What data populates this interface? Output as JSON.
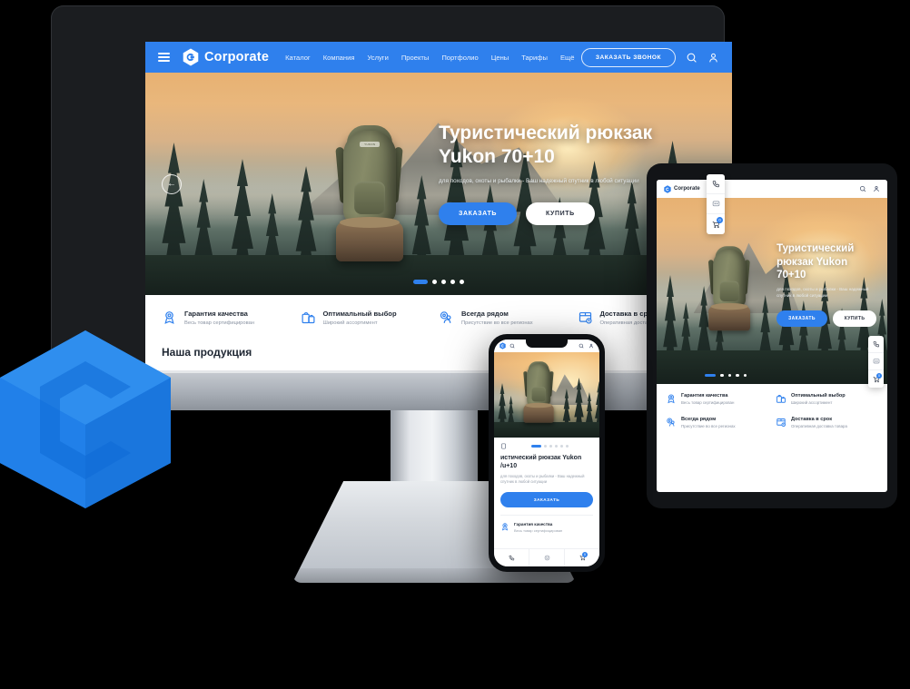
{
  "brand": {
    "name": "Corporate",
    "logo_icon": "hexagon-c-logo"
  },
  "header": {
    "menu_icon": "hamburger-menu-icon",
    "nav": [
      {
        "label": "Каталог"
      },
      {
        "label": "Компания"
      },
      {
        "label": "Услуги"
      },
      {
        "label": "Проекты"
      },
      {
        "label": "Портфолио"
      },
      {
        "label": "Цены"
      },
      {
        "label": "Тарифы"
      },
      {
        "label": "Ещё"
      }
    ],
    "cta_label": "ЗАКАЗАТЬ ЗВОНОК",
    "search_icon": "search-icon",
    "account_icon": "user-account-icon"
  },
  "hero": {
    "title_line1": "Туристический рюкзак",
    "title_line2": "Yukon 70+10",
    "subtitle": "для походов, охоты и рыбалки - Ваш надежный спутник в любой ситуации",
    "primary_button": "ЗАКАЗАТЬ",
    "secondary_button": "КУПИТЬ",
    "prev_icon": "arrow-left-icon",
    "next_icon": "arrow-right-icon",
    "slide_count": 5,
    "active_slide": 1,
    "backpack_label": "YUKON"
  },
  "features": [
    {
      "title": "Гарантия качества",
      "subtitle": "Весь товар сертифицирован",
      "icon": "quality-badge-icon"
    },
    {
      "title": "Оптимальный выбор",
      "subtitle": "Широкий ассортимент",
      "icon": "shopping-bags-icon"
    },
    {
      "title": "Всегда рядом",
      "subtitle": "Присутствие во все регионах",
      "icon": "map-pin-icon"
    },
    {
      "title": "Доставка в срок",
      "subtitle": "Оперативная доставка товара",
      "icon": "delivery-box-icon"
    }
  ],
  "section": {
    "products_heading": "Наша продукция"
  },
  "dock": [
    {
      "icon": "phone-icon",
      "badge": ""
    },
    {
      "icon": "chat-message-icon",
      "badge": ""
    },
    {
      "icon": "shopping-cart-icon",
      "badge": "0"
    }
  ],
  "tablet": {
    "title_line1": "Туристический",
    "title_line2": "рюкзак Yukon",
    "title_line3": "70+10",
    "subtitle": "для походов, охоты и рыбалки - Ваш надежный спутник в любой ситуации",
    "primary_button": "ЗАКАЗАТЬ",
    "secondary_button": "КУПИТЬ",
    "slide_count": 5,
    "active_slide": 1
  },
  "phone": {
    "title_line1": "истический рюкзак Yukon",
    "title_line2": "/u+10",
    "subtitle": "для походов, охоты и рыбалки - Ваш надежный спутник в любой ситуации",
    "primary_button": "ЗАКАЗАТЬ",
    "feature_title": "Гарантия качества",
    "feature_subtitle": "Весь товар сертифицирован",
    "slide_count": 6,
    "active_slide": 1,
    "tabs": [
      {
        "icon": "phone-icon",
        "badge": ""
      },
      {
        "icon": "support-face-icon",
        "badge": ""
      },
      {
        "icon": "shopping-cart-icon",
        "badge": "0"
      }
    ]
  },
  "colors": {
    "accent": "#2f80ed",
    "header_bg": "#2f80ed",
    "text_dark": "#1f2733",
    "text_muted": "#8b94a3",
    "page_bg": "#000000"
  },
  "watermark": {
    "icon": "hexagon-cube-logo"
  }
}
